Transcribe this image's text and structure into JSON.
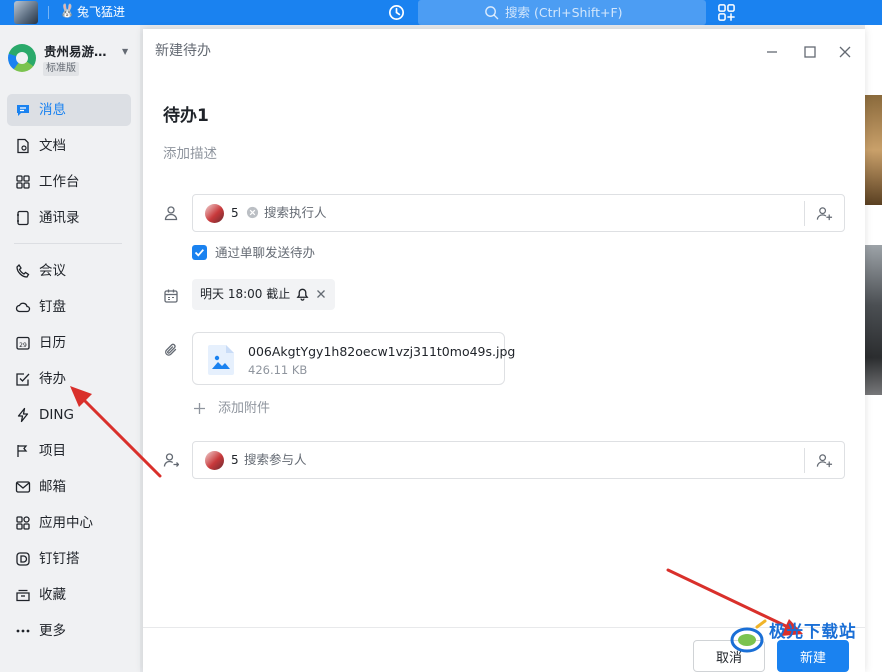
{
  "topbar": {
    "username": "兔飞猛进",
    "search_placeholder": "搜索 (Ctrl+Shift+F)"
  },
  "sidebar": {
    "org_name": "贵州易游…",
    "org_badge": "标准版",
    "items": [
      {
        "label": "消息",
        "icon": "message-icon",
        "active": true
      },
      {
        "label": "文档",
        "icon": "document-icon"
      },
      {
        "label": "工作台",
        "icon": "workbench-icon"
      },
      {
        "label": "通讯录",
        "icon": "contacts-icon"
      },
      {
        "label": "会议",
        "icon": "meeting-icon"
      },
      {
        "label": "钉盘",
        "icon": "cloud-drive-icon"
      },
      {
        "label": "日历",
        "icon": "calendar-icon"
      },
      {
        "label": "待办",
        "icon": "todo-icon"
      },
      {
        "label": "DING",
        "icon": "ding-icon"
      },
      {
        "label": "项目",
        "icon": "project-icon"
      },
      {
        "label": "邮箱",
        "icon": "mail-icon"
      },
      {
        "label": "应用中心",
        "icon": "app-center-icon"
      },
      {
        "label": "钉钉搭",
        "icon": "dingda-icon"
      },
      {
        "label": "收藏",
        "icon": "favorites-icon"
      },
      {
        "label": "更多",
        "icon": "more-icon"
      }
    ]
  },
  "dialog": {
    "title": "新建待办",
    "todo_title": "待办1",
    "description_placeholder": "添加描述",
    "assignee": {
      "count": "5",
      "placeholder": "搜索执行人"
    },
    "send_via_chat_label": "通过单聊发送待办",
    "send_via_chat_checked": true,
    "due": {
      "text": "明天 18:00 截止"
    },
    "attachment": {
      "name": "006AkgtYgy1h82oecw1vzj311t0mo49s.jpg",
      "size": "426.11 KB"
    },
    "add_attachment_label": "添加附件",
    "participants": {
      "count": "5",
      "placeholder": "搜索参与人"
    },
    "cancel_label": "取消",
    "create_label": "新建"
  },
  "watermark": {
    "text": "极光下载站"
  },
  "colors": {
    "accent": "#1a82f0",
    "annotation_arrow": "#d9302b"
  }
}
